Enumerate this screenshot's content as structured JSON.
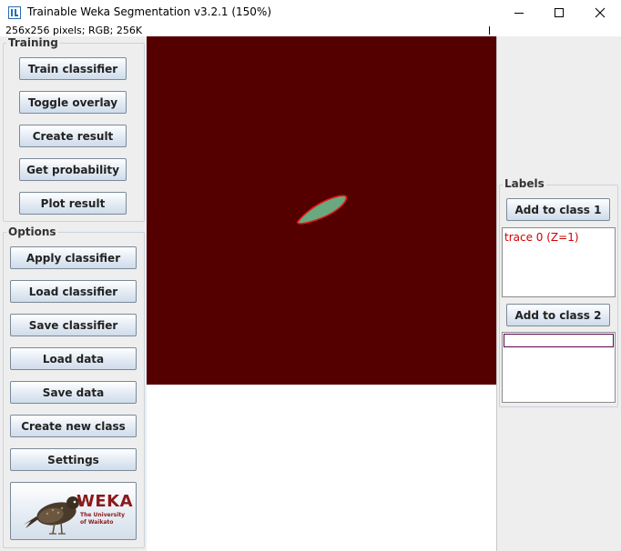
{
  "window": {
    "title": "Trainable Weka Segmentation v3.2.1 (150%)",
    "status": "256x256 pixels; RGB; 256K",
    "controls": {
      "minimize": "–",
      "maximize": "☐",
      "close": "✕"
    }
  },
  "training": {
    "label": "Training",
    "buttons": [
      "Train classifier",
      "Toggle overlay",
      "Create result",
      "Get probability",
      "Plot result"
    ]
  },
  "options": {
    "label": "Options",
    "buttons": [
      "Apply classifier",
      "Load classifier",
      "Save classifier",
      "Load data",
      "Save data",
      "Create new class",
      "Settings"
    ]
  },
  "logo": {
    "name": "WEKA",
    "line1": "The University",
    "line2": "of Waikato"
  },
  "labels": {
    "label": "Labels",
    "class1_button": "Add to class 1",
    "class1_traces": [
      "trace 0 (Z=1)"
    ],
    "class2_button": "Add to class 2",
    "class2_traces": []
  },
  "colors": {
    "image_background": "#540000",
    "segment_fill": "#6aa880",
    "trace_outline": "#e01818",
    "trace_text": "#d00000"
  }
}
